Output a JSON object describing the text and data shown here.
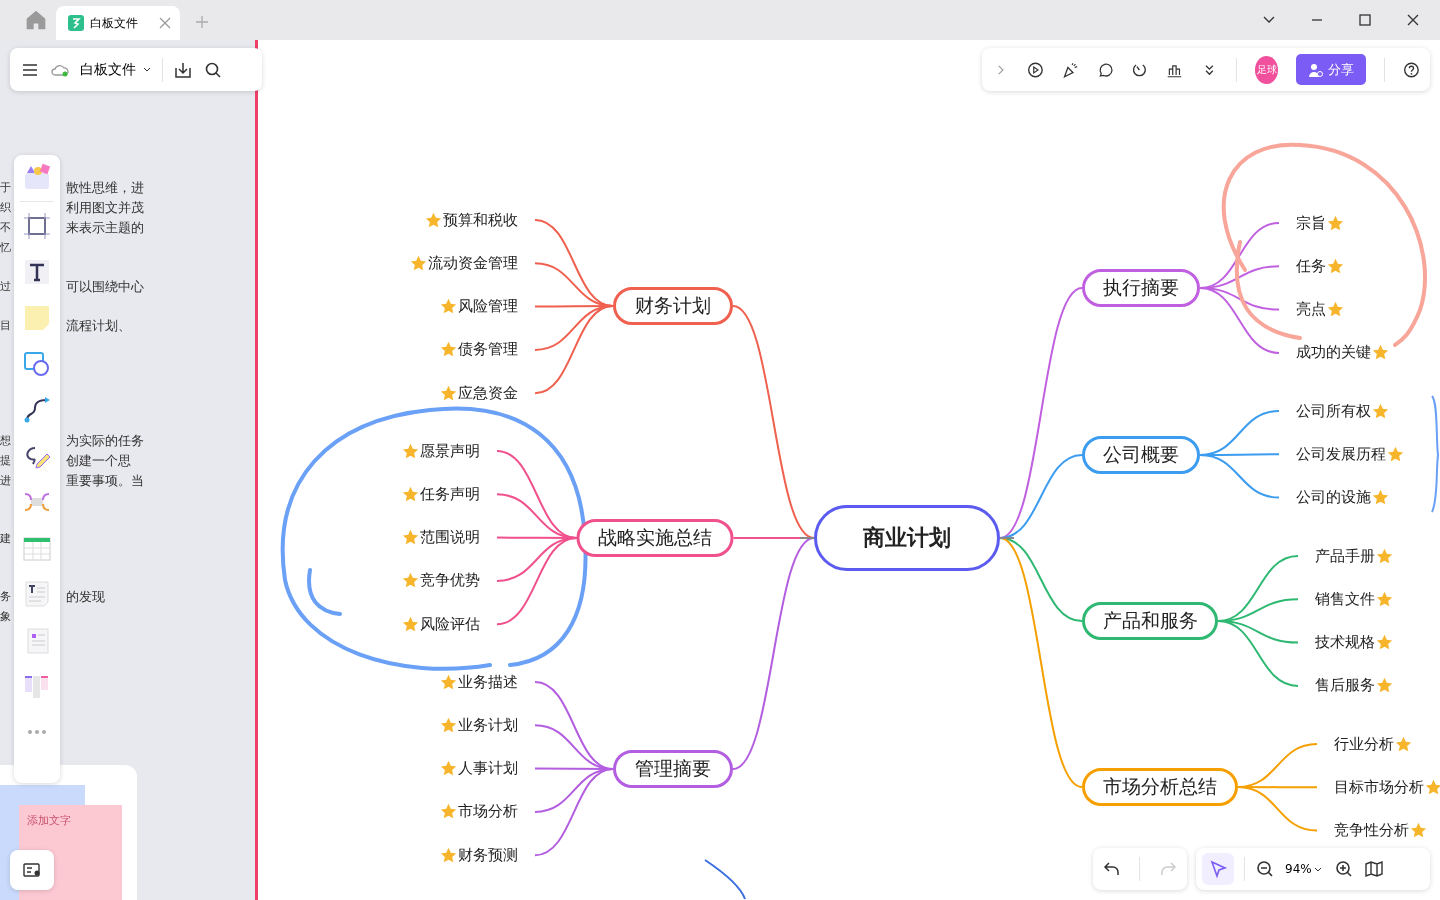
{
  "tabs": [
    {
      "label": "白板文件",
      "selected": true
    }
  ],
  "file_bar": {
    "title": "白板文件"
  },
  "top_toolbar": {
    "avatar": "足球",
    "share": "分享"
  },
  "left_panel": {
    "lines": [
      {
        "left": "于",
        "right": "散性思维，进"
      },
      {
        "left": "织",
        "right": "利用图文并茂"
      },
      {
        "left": "不",
        "right": "来表示主题的"
      },
      {
        "left": "忆"
      },
      {
        "left": "过",
        "right": "可以围绕中心"
      },
      {
        "left": "目",
        "right": "流程计划、"
      },
      {
        "left": "想",
        "right": "为实际的任务"
      },
      {
        "left": "提",
        "right": "创建一个思"
      },
      {
        "left": "进",
        "right": "重要事项。当"
      },
      {
        "left": "建"
      },
      {
        "left": "务",
        "right": "的发现"
      },
      {
        "left": "象"
      }
    ],
    "sticky": "添加文字"
  },
  "mindmap": {
    "root": "商业计划",
    "left_branches": [
      {
        "label": "财务计划",
        "color": "#f0604f",
        "children": [
          {
            "label": "预算和税收"
          },
          {
            "label": "流动资金管理"
          },
          {
            "label": "风险管理"
          },
          {
            "label": "债务管理"
          },
          {
            "label": "应急资金"
          }
        ]
      },
      {
        "label": "战略实施总结",
        "color": "#f0508c",
        "children": [
          {
            "label": "愿景声明"
          },
          {
            "label": "任务声明"
          },
          {
            "label": "范围说明"
          },
          {
            "label": "竞争优势"
          },
          {
            "label": "风险评估"
          }
        ]
      },
      {
        "label": "管理摘要",
        "color": "#b35de0",
        "children": [
          {
            "label": "业务描述"
          },
          {
            "label": "业务计划"
          },
          {
            "label": "人事计划"
          },
          {
            "label": "市场分析"
          },
          {
            "label": "财务预测"
          }
        ]
      }
    ],
    "right_branches": [
      {
        "label": "执行摘要",
        "color": "#c060e0",
        "children": [
          {
            "label": "宗旨"
          },
          {
            "label": "任务"
          },
          {
            "label": "亮点"
          },
          {
            "label": "成功的关键"
          }
        ]
      },
      {
        "label": "公司概要",
        "color": "#3b9cf0",
        "children": [
          {
            "label": "公司所有权"
          },
          {
            "label": "公司发展历程"
          },
          {
            "label": "公司的设施"
          }
        ]
      },
      {
        "label": "产品和服务",
        "color": "#2eb872",
        "children": [
          {
            "label": "产品手册"
          },
          {
            "label": "销售文件"
          },
          {
            "label": "技术规格"
          },
          {
            "label": "售后服务"
          }
        ]
      },
      {
        "label": "市场分析总结",
        "color": "#f5a000",
        "children": [
          {
            "label": "行业分析"
          },
          {
            "label": "目标市场分析"
          },
          {
            "label": "竞争性分析"
          }
        ]
      }
    ]
  },
  "zoom_bar": {
    "pointer_selected": true,
    "zoom": "94%"
  }
}
